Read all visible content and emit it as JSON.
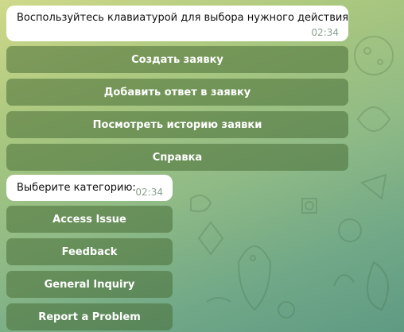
{
  "chat": {
    "message1": {
      "text": "Воспользуйтесь клавиатурой для выбора нужного действия",
      "time": "02:34"
    },
    "keyboard1": [
      {
        "label": "Создать заявку"
      },
      {
        "label": "Добавить ответ в заявку"
      },
      {
        "label": "Посмотреть историю заявки"
      },
      {
        "label": "Справка"
      }
    ],
    "message2": {
      "text": "Выберите категорию:",
      "time": "02:34"
    },
    "keyboard2": [
      {
        "label": "Access Issue"
      },
      {
        "label": "Feedback"
      },
      {
        "label": "General Inquiry"
      },
      {
        "label": "Report a Problem"
      }
    ]
  },
  "colors": {
    "background_top": "#cfd98a",
    "background_bottom": "#5f9a83",
    "bubble": "#ffffff",
    "keyboard_button": "#5a7e45",
    "timestamp": "#8aa28f"
  }
}
